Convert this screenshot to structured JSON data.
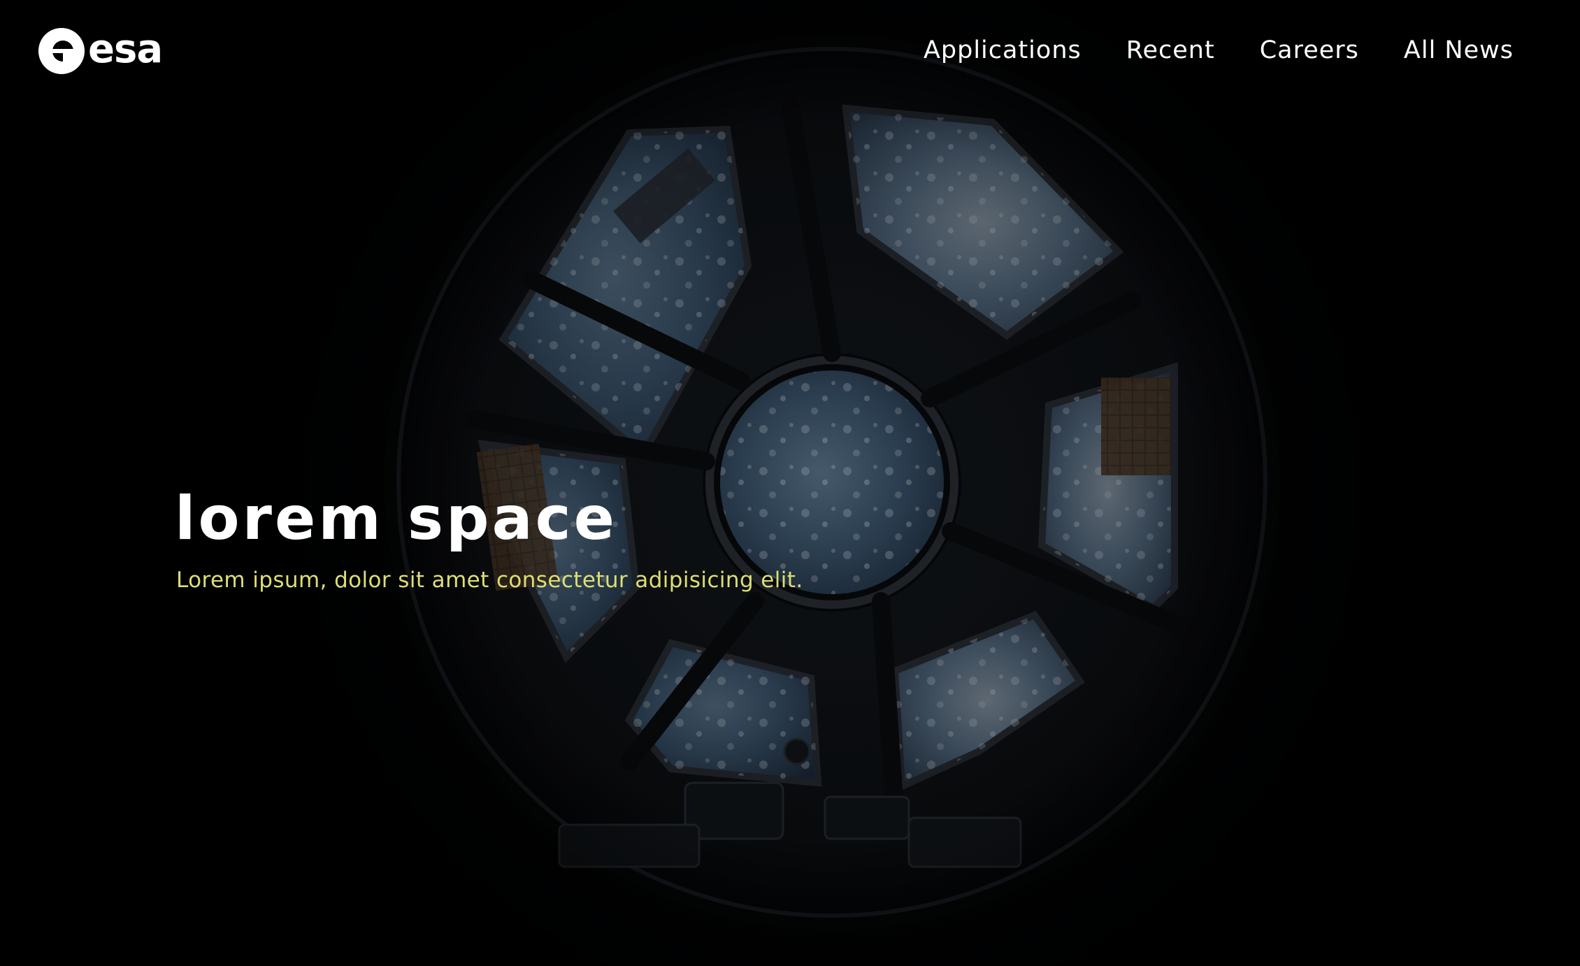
{
  "brand": {
    "logo_text": "esa"
  },
  "nav": {
    "items": [
      {
        "label": "Applications"
      },
      {
        "label": "Recent"
      },
      {
        "label": "Careers"
      },
      {
        "label": "All News"
      }
    ]
  },
  "hero": {
    "title": "lorem space",
    "subtitle": "Lorem ipsum, dolor sit amet consectetur adipisicing elit.",
    "background": "space-station-cupola-window",
    "title_color": "#ffffff",
    "subtitle_color": "#dede74"
  },
  "colors": {
    "background": "#030405",
    "text": "#ffffff",
    "accent": "#dede74"
  }
}
